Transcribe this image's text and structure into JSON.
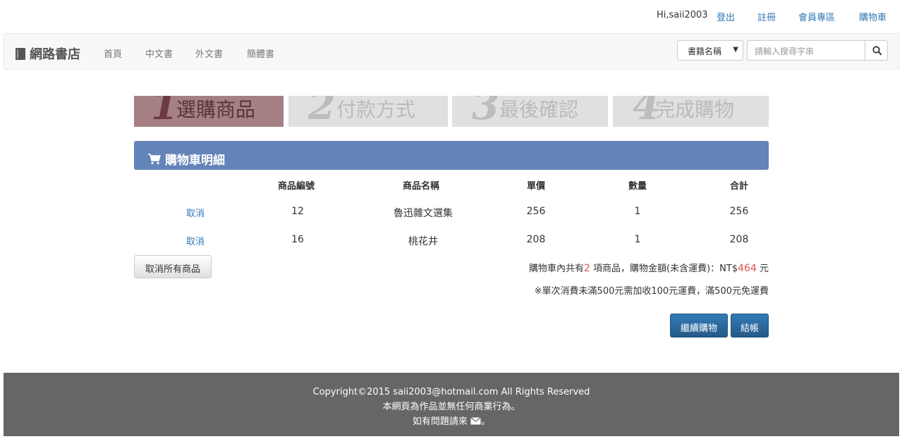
{
  "topbar": {
    "greeting": "Hi,saii2003",
    "logout": "登出",
    "register": "註冊",
    "member": "會員專區",
    "cart": "購物車"
  },
  "navbar": {
    "brand": "網路書店",
    "links": [
      "首頁",
      "中文書",
      "外文書",
      "簡體書"
    ],
    "search_select": "書籍名稱",
    "search_placeholder": "請輸入搜尋字串"
  },
  "steps": [
    {
      "num": "1",
      "label": "選購商品",
      "active": true
    },
    {
      "num": "2",
      "label": "付款方式",
      "active": false
    },
    {
      "num": "3",
      "label": "最後確認",
      "active": false
    },
    {
      "num": "4",
      "label": "完成購物",
      "active": false
    }
  ],
  "cart": {
    "title": "購物車明細",
    "headers": [
      "商品編號",
      "商品名稱",
      "單價",
      "數量",
      "合計"
    ],
    "rows": [
      {
        "action": "取消",
        "id": "12",
        "name": "魯迅雜文選集",
        "price": "256",
        "qty": "1",
        "total": "256"
      },
      {
        "action": "取消",
        "id": "16",
        "name": "桃花井",
        "price": "208",
        "qty": "1",
        "total": "208"
      }
    ],
    "cancel_all": "取消所有商品",
    "summary_pre": "購物車內共有",
    "summary_count": "2",
    "summary_mid": " 項商品，購物金額(未含運費)：NT$",
    "summary_amount": "464",
    "summary_post": " 元",
    "note": "※單次消費未滿500元需加收100元運費，滿500元免運費",
    "continue": "繼續購物",
    "checkout": "結帳"
  },
  "footer": {
    "line1": "Copyright©2015 saii2003@hotmail.com All Rights Reserved",
    "line2": "本網頁為作品並無任何商業行為。",
    "line3_pre": "如有問題請來 ",
    "line3_post": "。"
  },
  "colors": {
    "accent": "#6483b9",
    "step_active": "#a57f83",
    "footer": "#666666",
    "primary_button": "#2b6ca3"
  }
}
